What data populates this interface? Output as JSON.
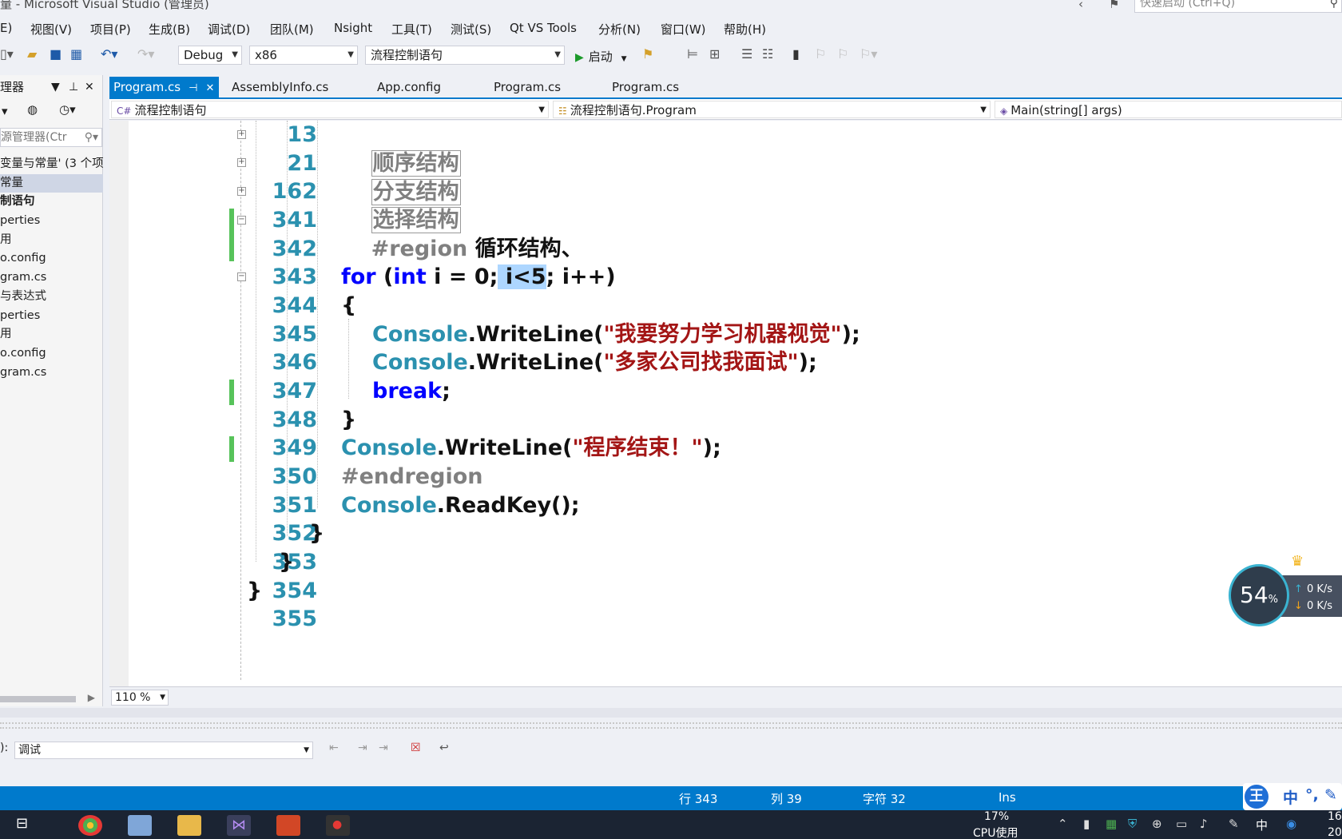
{
  "window": {
    "title": "量 - Microsoft Visual Studio (管理员)",
    "quick_launch_placeholder": "快速启动 (Ctrl+Q)"
  },
  "menu": [
    "E)",
    "视图(V)",
    "项目(P)",
    "生成(B)",
    "调试(D)",
    "团队(M)",
    "Nsight",
    "工具(T)",
    "测试(S)",
    "Qt VS Tools",
    "分析(N)",
    "窗口(W)",
    "帮助(H)"
  ],
  "toolbar": {
    "config": "Debug",
    "platform": "x86",
    "project": "流程控制语句",
    "start_label": "启动"
  },
  "solution": {
    "title": "理器",
    "search_placeholder": "源管理器(Ctr",
    "items": [
      {
        "label": "变量与常量' (3 个项",
        "style": ""
      },
      {
        "label": "常量",
        "style": "sel"
      },
      {
        "label": "制语句",
        "style": "bold"
      },
      {
        "label": "perties",
        "style": ""
      },
      {
        "label": "用",
        "style": ""
      },
      {
        "label": "o.config",
        "style": ""
      },
      {
        "label": "gram.cs",
        "style": ""
      },
      {
        "label": "与表达式",
        "style": ""
      },
      {
        "label": "perties",
        "style": ""
      },
      {
        "label": "用",
        "style": ""
      },
      {
        "label": "o.config",
        "style": ""
      },
      {
        "label": "gram.cs",
        "style": ""
      }
    ]
  },
  "tabs": [
    {
      "label": "Program.cs",
      "active": true
    },
    {
      "label": "AssemblyInfo.cs",
      "active": false
    },
    {
      "label": "App.config",
      "active": false
    },
    {
      "label": "Program.cs",
      "active": false
    },
    {
      "label": "Program.cs",
      "active": false
    }
  ],
  "navbar": {
    "project": "流程控制语句",
    "type": "流程控制语句.Program",
    "member": "Main(string[] args)"
  },
  "code": {
    "line_numbers": [
      "13",
      "21",
      "162",
      "341",
      "342",
      "343",
      "344",
      "345",
      "346",
      "347",
      "348",
      "349",
      "350",
      "351",
      "352",
      "353",
      "354",
      "355"
    ],
    "region_seq": "顺序结构",
    "region_branch": "分支结构",
    "region_select": "选择结构",
    "region_kw": "#region",
    "region_name": "循环结构、",
    "for_kw": "for",
    "paren_open": "(",
    "int_kw": "int",
    "for_init": " i = 0;",
    "for_cond": " i<5",
    "for_rest": "; i++)",
    "brace_open": "{",
    "console": "Console",
    "writeline": ".WriteLine(",
    "str1": "\"我要努力学习机器视觉\"",
    "str2": "\"多家公司找我面试\"",
    "str3": "\"程序结束！\"",
    "call_end": ");",
    "break_kw": "break",
    "semicolon": ";",
    "brace_close": "}",
    "endregion": "#endregion",
    "readkey": ".ReadKey();"
  },
  "zoom": "110 %",
  "output": {
    "label": "):",
    "source": "调试"
  },
  "status": {
    "line": "行 343",
    "col": "列 39",
    "char": "字符 32",
    "mode": "Ins"
  },
  "ime": {
    "wang": "王",
    "zhong": "中",
    "dot": "°,",
    "pen": "✎"
  },
  "net_widget": {
    "cpu_percent": "54",
    "percent_sign": "%",
    "up": "0 K/s",
    "down": "0 K/s"
  },
  "taskbar": {
    "cpu": "17%",
    "cpu_label": "CPU使用",
    "lang": "中",
    "clock": "16",
    "date": "20"
  }
}
